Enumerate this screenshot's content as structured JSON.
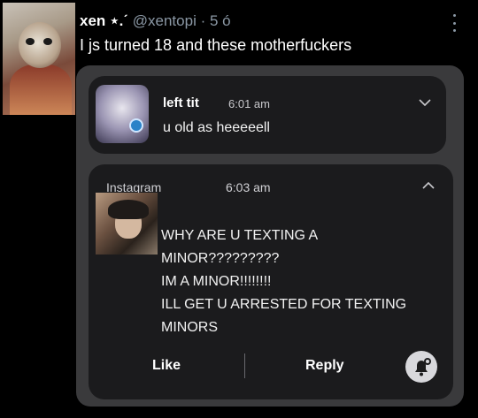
{
  "tweet": {
    "display_name": "xen ⋆.ˊ",
    "handle_time": " @xentopi · 5 ó",
    "text": "I js turned 18 and these motherfuckers",
    "more_icon": "three-dots-vertical-icon"
  },
  "notification_1": {
    "sender": "left tit",
    "time": "6:01 am",
    "message": "u old as heeeeell",
    "chevron_icon": "chevron-down-icon"
  },
  "notification_2": {
    "app": "Instagram",
    "time": "6:03 am",
    "chevron_icon": "chevron-up-icon",
    "message_lines": [
      "WHY ARE U TEXTING A",
      "MINOR?????????",
      "IM A MINOR!!!!!!!!",
      "ILL GET U ARRESTED FOR TEXTING",
      "MINORS"
    ],
    "actions": {
      "like": "Like",
      "reply": "Reply"
    },
    "bell_icon": "bell-snooze-icon"
  },
  "colors": {
    "background": "#000000",
    "card": "#3a3a3c",
    "notification": "#1b1b1d",
    "muted_text": "#8b98a5"
  }
}
